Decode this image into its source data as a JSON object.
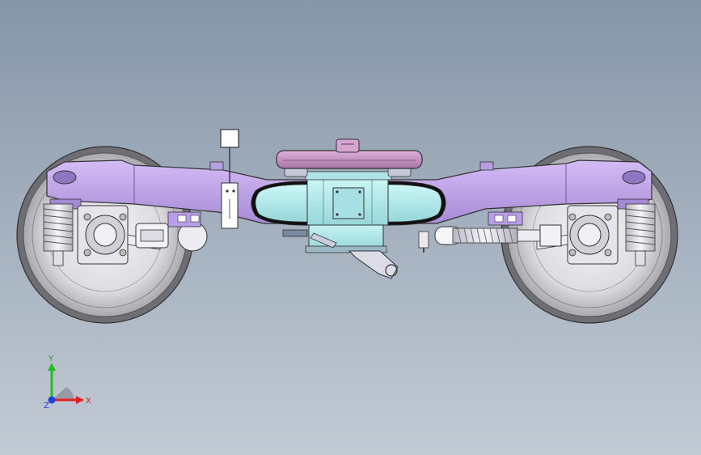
{
  "viewport": {
    "background_top": "#8696a8",
    "background_bottom": "#c2cad4"
  },
  "model": {
    "frame_color": "#c4a8ee",
    "bolster_color": "#b8eef0",
    "wheel_color": "#d8d8dc",
    "spring_color": "#ececf2",
    "center_plate_color": "#c996c6"
  },
  "triad": {
    "x_label": "X",
    "y_label": "Y",
    "z_label": "Z",
    "x_color": "#e02020",
    "y_color": "#20c020",
    "z_color": "#2040e0"
  }
}
